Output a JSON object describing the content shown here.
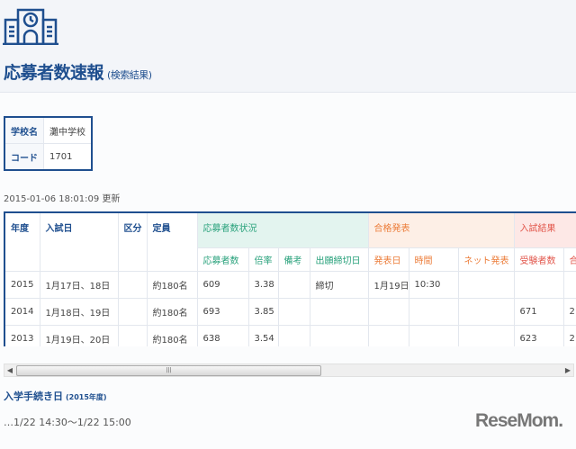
{
  "header": {
    "title": "応募者数速報",
    "subtitle": "(検索結果)"
  },
  "school": {
    "name_label": "学校名",
    "name": "灘中学校",
    "code_label": "コード",
    "code": "1701"
  },
  "updated": "2015-01-06 18:01:09 更新",
  "table": {
    "head": {
      "year": "年度",
      "date": "入試日",
      "division": "区分",
      "capacity": "定員",
      "apply_group": "応募者数状況",
      "pass_group": "合格発表",
      "result_group": "入試結果"
    },
    "sub": [
      "応募者数",
      "倍率",
      "備考",
      "出願締切日",
      "発表日",
      "時間",
      "ネット発表",
      "受験者数",
      "合"
    ],
    "rows": [
      [
        "2015",
        "1月17日、18日",
        "",
        "約180名",
        "609",
        "3.38",
        "",
        "締切",
        "1月19日",
        "10:30",
        "",
        "",
        ""
      ],
      [
        "2014",
        "1月18日、19日",
        "",
        "約180名",
        "693",
        "3.85",
        "",
        "",
        "",
        "",
        "",
        "671",
        "2"
      ],
      [
        "2013",
        "1月19日、20日",
        "",
        "約180名",
        "638",
        "3.54",
        "",
        "",
        "",
        "",
        "",
        "623",
        "2"
      ]
    ]
  },
  "procedure": {
    "title": "入学手続き日",
    "year": "(2015年度)",
    "text": "…1/22 14:30～1/22 15:00"
  },
  "brand": "ReseMom",
  "colors": {
    "primary": "#1f4f8f",
    "green": "#2aa27c",
    "orange": "#ec7d3a",
    "red": "#e2574c"
  }
}
